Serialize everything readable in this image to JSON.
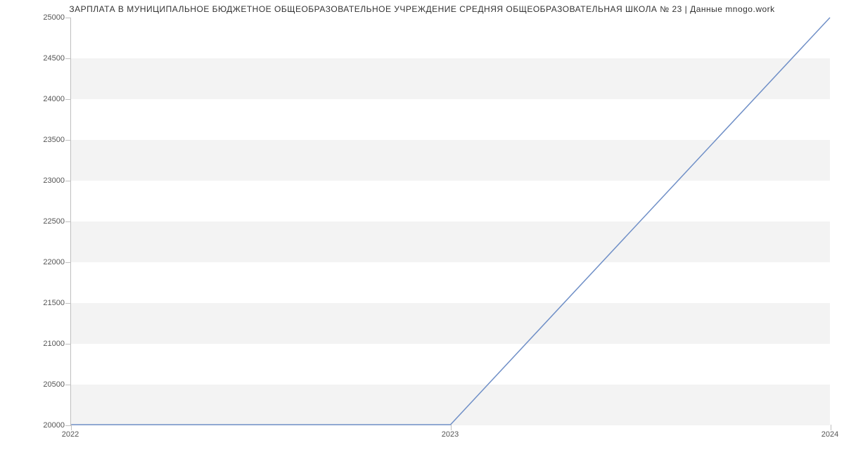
{
  "chart_data": {
    "type": "line",
    "title": "ЗАРПЛАТА В МУНИЦИПАЛЬНОЕ БЮДЖЕТНОЕ ОБЩЕОБРАЗОВАТЕЛЬНОЕ УЧРЕЖДЕНИЕ СРЕДНЯЯ ОБЩЕОБРАЗОВАТЕЛЬНАЯ ШКОЛА № 23 | Данные mnogo.work",
    "x": [
      2022,
      2023,
      2024
    ],
    "values": [
      20000,
      20000,
      25000
    ],
    "x_ticks": [
      2022,
      2023,
      2024
    ],
    "y_ticks": [
      20000,
      20500,
      21000,
      21500,
      22000,
      22500,
      23000,
      23500,
      24000,
      24500,
      25000
    ],
    "xlabel": "",
    "ylabel": "",
    "xlim": [
      2022,
      2024
    ],
    "ylim": [
      20000,
      25000
    ],
    "line_color": "#6f8fc7"
  }
}
